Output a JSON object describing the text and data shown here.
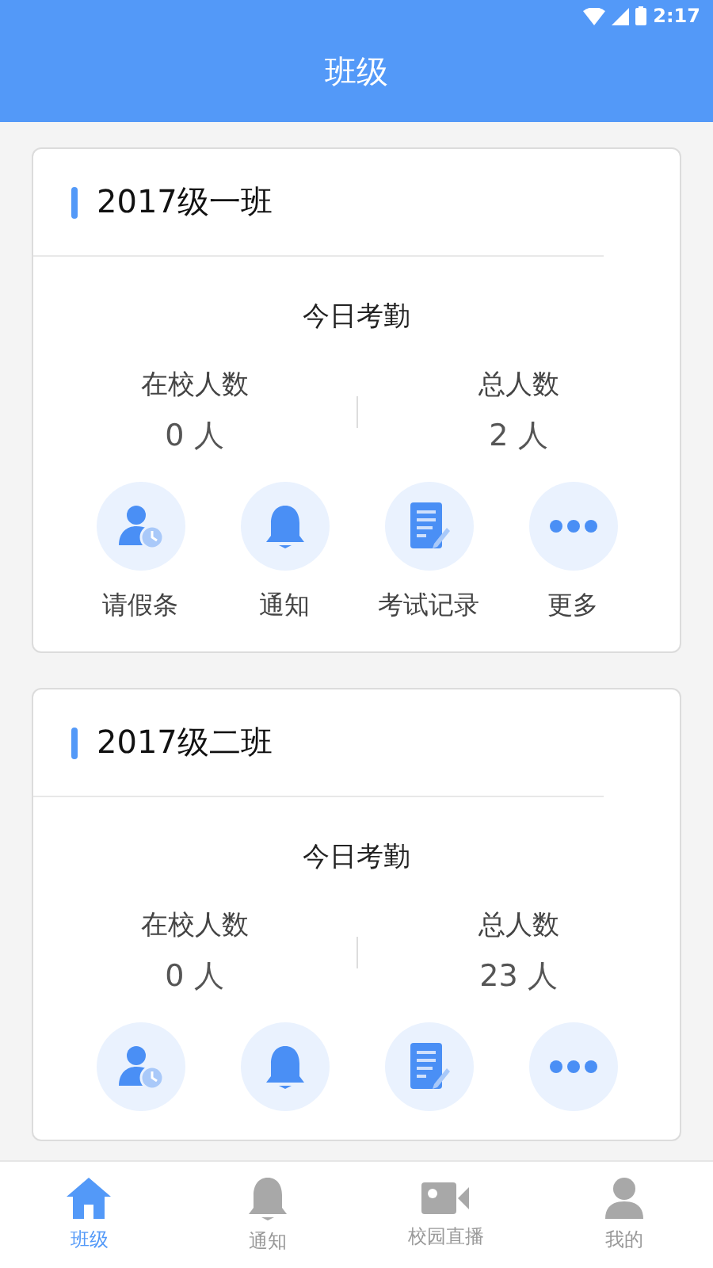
{
  "status_bar": {
    "time": "2:17"
  },
  "header": {
    "title": "班级"
  },
  "classes": [
    {
      "name": "2017级一班",
      "attendance_title": "今日考勤",
      "stats": [
        {
          "label": "在校人数",
          "value": "0 人"
        },
        {
          "label": "总人数",
          "value": "2 人"
        }
      ],
      "actions": [
        {
          "kind": "leave",
          "label": "请假条"
        },
        {
          "kind": "notice",
          "label": "通知"
        },
        {
          "kind": "exam",
          "label": "考试记录"
        },
        {
          "kind": "more",
          "label": "更多"
        }
      ]
    },
    {
      "name": "2017级二班",
      "attendance_title": "今日考勤",
      "stats": [
        {
          "label": "在校人数",
          "value": "0 人"
        },
        {
          "label": "总人数",
          "value": "23 人"
        }
      ],
      "actions": [
        {
          "kind": "leave"
        },
        {
          "kind": "notice"
        },
        {
          "kind": "exam"
        },
        {
          "kind": "more"
        }
      ]
    }
  ],
  "tab_bar": [
    {
      "kind": "home",
      "label": "班级",
      "selected": true
    },
    {
      "kind": "notice",
      "label": "通知",
      "selected": false
    },
    {
      "kind": "video",
      "label": "校园直播",
      "selected": false
    },
    {
      "kind": "person",
      "label": "我的",
      "selected": false
    }
  ]
}
